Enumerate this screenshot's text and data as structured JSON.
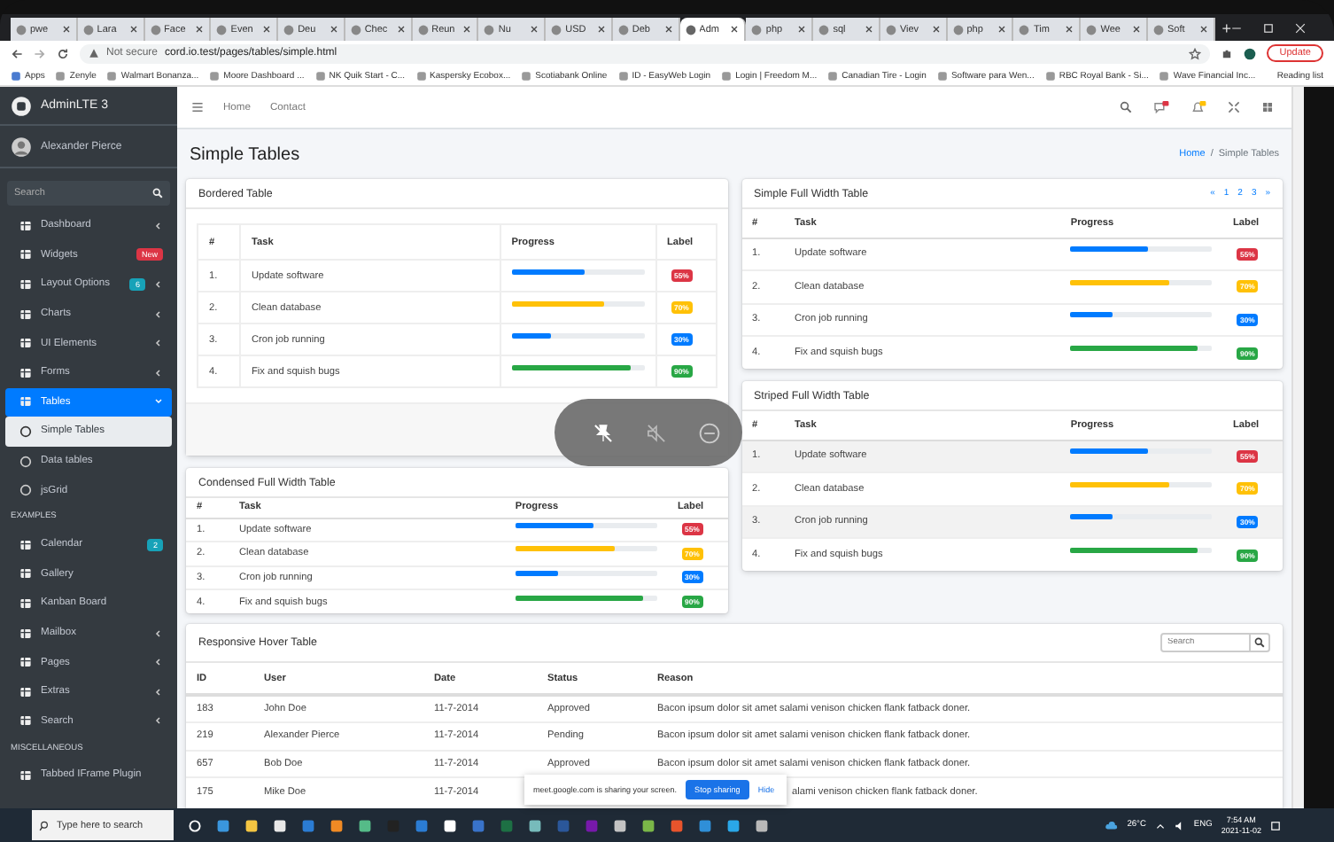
{
  "browser": {
    "tabs": [
      {
        "title": "pwe",
        "selected": false
      },
      {
        "title": "Lara",
        "selected": false
      },
      {
        "title": "Face",
        "selected": false
      },
      {
        "title": "Even",
        "selected": false
      },
      {
        "title": "Deu",
        "selected": false
      },
      {
        "title": "Chec",
        "selected": false
      },
      {
        "title": "Reun",
        "selected": false
      },
      {
        "title": "Nu",
        "selected": false
      },
      {
        "title": "USD",
        "selected": false
      },
      {
        "title": "Deb",
        "selected": false
      },
      {
        "title": "Adm",
        "selected": true
      },
      {
        "title": "php",
        "selected": false
      },
      {
        "title": "sql",
        "selected": false
      },
      {
        "title": "Viev",
        "selected": false
      },
      {
        "title": "php",
        "selected": false
      },
      {
        "title": "Tim",
        "selected": false
      },
      {
        "title": "Wee",
        "selected": false
      },
      {
        "title": "Soft",
        "selected": false
      }
    ],
    "new_tab": "+",
    "address": {
      "security": "Not secure",
      "url": "cord.io.test/pages/tables/simple.html"
    },
    "update_button": "Update",
    "bookmarks": [
      "Apps",
      "Zenyle",
      "Walmart Bonanza...",
      "Moore Dashboard ...",
      "NK Quik Start - C...",
      "Kaspersky Ecobox...",
      "Scotiabank Online",
      "ID - EasyWeb Login",
      "Login | Freedom M...",
      "Canadian Tire - Login",
      "Software para Wen...",
      "RBC Royal Bank - Si...",
      "Wave Financial Inc..."
    ],
    "reading_list": "Reading list"
  },
  "sidebar": {
    "brand": "AdminLTE 3",
    "user": "Alexander Pierce",
    "search": {
      "placeholder": "Search"
    },
    "items": [
      {
        "kind": "item",
        "label": "Dashboard",
        "selected": false,
        "expanded": false
      },
      {
        "kind": "item",
        "label": "Widgets",
        "selected": false,
        "badge": {
          "text": "New",
          "color": "#dc3545"
        }
      },
      {
        "kind": "item",
        "label": "Layout Options",
        "selected": false,
        "expanded": false,
        "badge": {
          "text": "6",
          "color": "#17a2b8"
        }
      },
      {
        "kind": "item",
        "label": "Charts",
        "selected": false,
        "expanded": false
      },
      {
        "kind": "item",
        "label": "UI Elements",
        "selected": false,
        "expanded": false
      },
      {
        "kind": "item",
        "label": "Forms",
        "selected": false,
        "expanded": false
      },
      {
        "kind": "item",
        "label": "Tables",
        "selected": true,
        "expanded": true
      },
      {
        "kind": "sub",
        "label": "Simple Tables",
        "selected": true
      },
      {
        "kind": "sub",
        "label": "Data tables",
        "selected": false
      },
      {
        "kind": "sub",
        "label": "jsGrid",
        "selected": false
      },
      {
        "kind": "header",
        "label": "EXAMPLES"
      },
      {
        "kind": "item",
        "label": "Calendar",
        "selected": false,
        "badge": {
          "text": "2",
          "color": "#17a2b8"
        }
      },
      {
        "kind": "item",
        "label": "Gallery",
        "selected": false
      },
      {
        "kind": "item",
        "label": "Kanban Board",
        "selected": false
      },
      {
        "kind": "item",
        "label": "Mailbox",
        "selected": false,
        "expanded": false
      },
      {
        "kind": "item",
        "label": "Pages",
        "selected": false,
        "expanded": false
      },
      {
        "kind": "item",
        "label": "Extras",
        "selected": false,
        "expanded": false
      },
      {
        "kind": "item",
        "label": "Search",
        "selected": false,
        "expanded": false
      },
      {
        "kind": "header",
        "label": "MISCELLANEOUS"
      },
      {
        "kind": "item",
        "label": "Tabbed IFrame Plugin",
        "selected": false
      }
    ]
  },
  "navbar": {
    "links": [
      "Home",
      "Contact"
    ]
  },
  "content": {
    "title": "Simple Tables",
    "breadcrumb": {
      "link": "Home",
      "separator": "/",
      "current": "Simple Tables"
    },
    "left": [
      {
        "title": "Bordered Table",
        "columns": [
          "#",
          "Task",
          "Progress",
          "Label"
        ],
        "rows": [
          {
            "num": "1.",
            "task": "Update software",
            "level": 0.55,
            "label": "55%",
            "color": "#dc3545"
          },
          {
            "num": "2.",
            "task": "Clean database",
            "level": 0.7,
            "label": "70%",
            "color": "#ffc107"
          },
          {
            "num": "3.",
            "task": "Cron job running",
            "level": 0.3,
            "label": "30%",
            "color": "#007bff"
          },
          {
            "num": "4.",
            "task": "Fix and squish bugs",
            "level": 0.9,
            "label": "90%",
            "color": "#28a745"
          }
        ]
      },
      {
        "title": "Condensed Full Width Table",
        "columns": [
          "#",
          "Task",
          "Progress",
          "Label"
        ],
        "rows": [
          {
            "num": "1.",
            "task": "Update software",
            "level": 0.55,
            "label": "55%",
            "color": "#dc3545"
          },
          {
            "num": "2.",
            "task": "Clean database",
            "level": 0.7,
            "label": "70%",
            "color": "#ffc107"
          },
          {
            "num": "3.",
            "task": "Cron job running",
            "level": 0.3,
            "label": "30%",
            "color": "#007bff"
          },
          {
            "num": "4.",
            "task": "Fix and squish bugs",
            "level": 0.9,
            "label": "90%",
            "color": "#28a745"
          }
        ]
      }
    ],
    "right": [
      {
        "title": "Simple Full Width Table",
        "pagination": [
          "«",
          "1",
          "2",
          "3",
          "»"
        ],
        "columns": [
          "#",
          "Task",
          "Progress",
          "Label"
        ],
        "rows": [
          {
            "num": "1.",
            "task": "Update software",
            "level": 0.55,
            "label": "55%",
            "color": "#dc3545"
          },
          {
            "num": "2.",
            "task": "Clean database",
            "level": 0.7,
            "label": "70%",
            "color": "#ffc107"
          },
          {
            "num": "3.",
            "task": "Cron job running",
            "level": 0.3,
            "label": "30%",
            "color": "#007bff"
          },
          {
            "num": "4.",
            "task": "Fix and squish bugs",
            "level": 0.9,
            "label": "90%",
            "color": "#28a745"
          }
        ]
      },
      {
        "title": "Striped Full Width Table",
        "columns": [
          "#",
          "Task",
          "Progress",
          "Label"
        ],
        "rows": [
          {
            "num": "1.",
            "task": "Update software",
            "level": 0.55,
            "label": "55%",
            "color": "#dc3545"
          },
          {
            "num": "2.",
            "task": "Clean database",
            "level": 0.7,
            "label": "70%",
            "color": "#ffc107"
          },
          {
            "num": "3.",
            "task": "Cron job running",
            "level": 0.3,
            "label": "30%",
            "color": "#007bff"
          },
          {
            "num": "4.",
            "task": "Fix and squish bugs",
            "level": 0.9,
            "label": "90%",
            "color": "#28a745"
          }
        ]
      }
    ],
    "hover_table": {
      "title": "Responsive Hover Table",
      "search": {
        "placeholder": "Search"
      },
      "columns": [
        "ID",
        "User",
        "Date",
        "Status",
        "Reason"
      ],
      "rows": [
        {
          "cells": [
            "183",
            "John Doe",
            "11-7-2014",
            "Approved",
            "Bacon ipsum dolor sit amet salami venison chicken flank fatback doner."
          ]
        },
        {
          "cells": [
            "219",
            "Alexander Pierce",
            "11-7-2014",
            "Pending",
            "Bacon ipsum dolor sit amet salami venison chicken flank fatback doner."
          ]
        },
        {
          "cells": [
            "657",
            "Bob Doe",
            "11-7-2014",
            "Approved",
            "Bacon ipsum dolor sit amet salami venison chicken flank fatback doner."
          ]
        },
        {
          "cells": [
            "175",
            "Mike Doe",
            "11-7-2014",
            null,
            "alami venison chicken flank fatback doner."
          ]
        }
      ]
    }
  },
  "share_bar": {
    "message": "meet.google.com is sharing your screen.",
    "stop_button": "Stop sharing",
    "hide_link": "Hide"
  },
  "taskbar": {
    "search": {
      "placeholder": "Type here to search"
    },
    "weather": "26°C",
    "language": "ENG",
    "time": "7:54 AM",
    "date": "2021-11-02"
  }
}
